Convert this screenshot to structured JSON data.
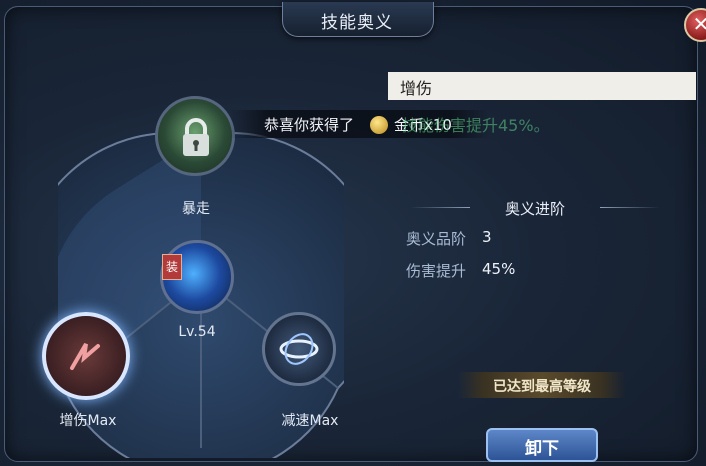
{
  "window": {
    "title": "技能奥义",
    "close_icon": "close-icon"
  },
  "skills": {
    "top": {
      "label": "暴走",
      "icon": "lock-icon",
      "locked": true
    },
    "center": {
      "label": "Lv.54",
      "badge": "装",
      "icon": "blue-flame-icon"
    },
    "left": {
      "label": "增伤Max",
      "icon": "red-slash-icon"
    },
    "right": {
      "label": "减速Max",
      "icon": "spiral-icon"
    }
  },
  "toast": {
    "text": "恭喜你获得了",
    "reward": "金币x10",
    "icon": "coin-icon"
  },
  "detail": {
    "title": "增伤",
    "description": "技能伤害提升45%。",
    "advance_title": "奥义进阶",
    "stats": [
      {
        "key": "奥义品阶",
        "value": "3"
      },
      {
        "key": "伤害提升",
        "value": "45%"
      }
    ],
    "max_text": "已达到最高等级",
    "unequip_label": "卸下"
  },
  "colors": {
    "accent": "#5dcf86",
    "button": "#2d5496",
    "close": "#b32a2a"
  }
}
